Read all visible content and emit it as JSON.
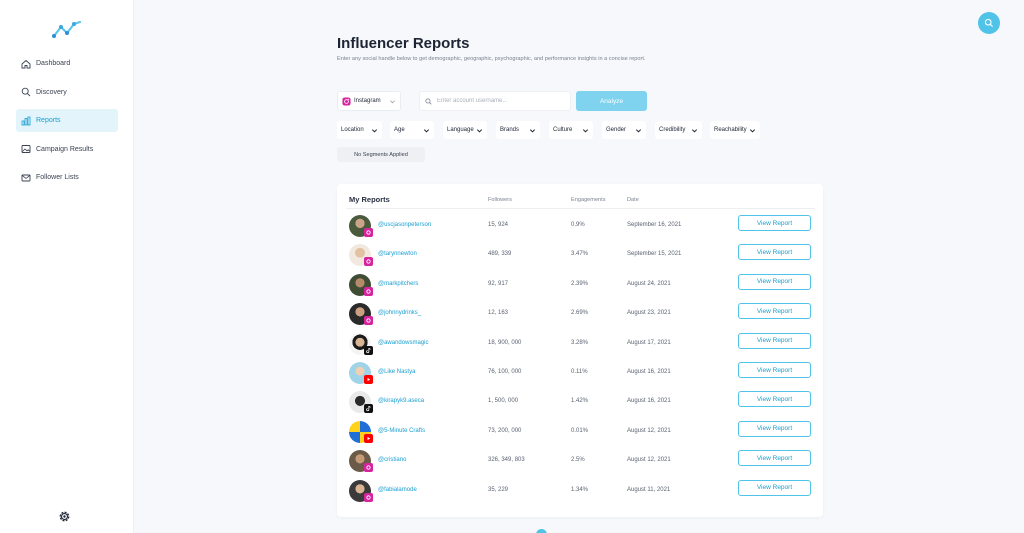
{
  "sidebar": {
    "items": [
      {
        "label": "Dashboard",
        "icon": "home-icon",
        "active": false
      },
      {
        "label": "Discovery",
        "icon": "search-icon",
        "active": false
      },
      {
        "label": "Reports",
        "icon": "bar-chart-icon",
        "active": true
      },
      {
        "label": "Campaign Results",
        "icon": "image-icon",
        "active": false
      },
      {
        "label": "Follower Lists",
        "icon": "mail-icon",
        "active": false
      }
    ]
  },
  "page": {
    "title": "Influencer Reports",
    "subtitle": "Enter any social handle below to get demographic, geographic, psychographic, and performance insights in a concise report."
  },
  "search": {
    "platform": "Instagram",
    "placeholder": "Enter account username...",
    "value": "",
    "analyze_label": "Analyze"
  },
  "filters": [
    "Location",
    "Age",
    "Language",
    "Brands",
    "Culture",
    "Gender",
    "Credibility",
    "Reachability"
  ],
  "segments_label": "No Segments Applied",
  "table": {
    "title": "My Reports",
    "columns": [
      "Followers",
      "Engagements",
      "Date"
    ],
    "button_label": "View Report",
    "rows": [
      {
        "handle": "@uscjasonpeterson",
        "followers": "15, 924",
        "engagement": "0.9%",
        "date": "September 16, 2021",
        "platform": "instagram"
      },
      {
        "handle": "@tarynnewton",
        "followers": "489, 339",
        "engagement": "3.47%",
        "date": "September 15, 2021",
        "platform": "instagram"
      },
      {
        "handle": "@markpitchers",
        "followers": "92, 917",
        "engagement": "2.39%",
        "date": "August 24, 2021",
        "platform": "instagram"
      },
      {
        "handle": "@johnnydrinks_",
        "followers": "12, 163",
        "engagement": "2.69%",
        "date": "August 23, 2021",
        "platform": "instagram"
      },
      {
        "handle": "@awandowsmagic",
        "followers": "18, 900, 000",
        "engagement": "3.28%",
        "date": "August 17, 2021",
        "platform": "tiktok"
      },
      {
        "handle": "@Like Nastya",
        "followers": "76, 100, 000",
        "engagement": "0.11%",
        "date": "August 16, 2021",
        "platform": "youtube"
      },
      {
        "handle": "@kirapyk9.aseca",
        "followers": "1, 500, 000",
        "engagement": "1.42%",
        "date": "August 16, 2021",
        "platform": "tiktok"
      },
      {
        "handle": "@5-Minute Crafts",
        "followers": "73, 200, 000",
        "engagement": "0.01%",
        "date": "August 12, 2021",
        "platform": "youtube"
      },
      {
        "handle": "@cristiano",
        "followers": "326, 349, 803",
        "engagement": "2.5%",
        "date": "August 12, 2021",
        "platform": "instagram"
      },
      {
        "handle": "@fabialamode",
        "followers": "35, 229",
        "engagement": "1.34%",
        "date": "August 11, 2021",
        "platform": "instagram"
      }
    ]
  },
  "colors": {
    "accent": "#4fc3e8",
    "link": "#1a9fd0",
    "active_bg": "#e3f4fb",
    "instagram": "#d6249f",
    "youtube": "#ff0000",
    "tiktok": "#111111"
  }
}
